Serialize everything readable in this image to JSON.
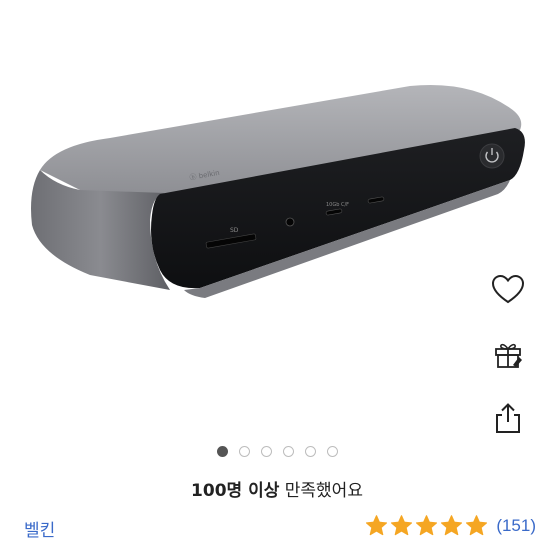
{
  "carousel": {
    "total": 6,
    "active": 0
  },
  "satisfaction": {
    "bold": "100명 이상",
    "rest": " 만족했어요"
  },
  "brand": {
    "name": "벨킨"
  },
  "rating": {
    "stars": 5,
    "count_label": "(151)"
  },
  "icons": [
    "heart-icon",
    "gift-icon",
    "share-icon",
    "star-icon"
  ],
  "colors": {
    "link": "#3a6ac9",
    "star": "#f5a623",
    "dot_active": "#555555"
  }
}
